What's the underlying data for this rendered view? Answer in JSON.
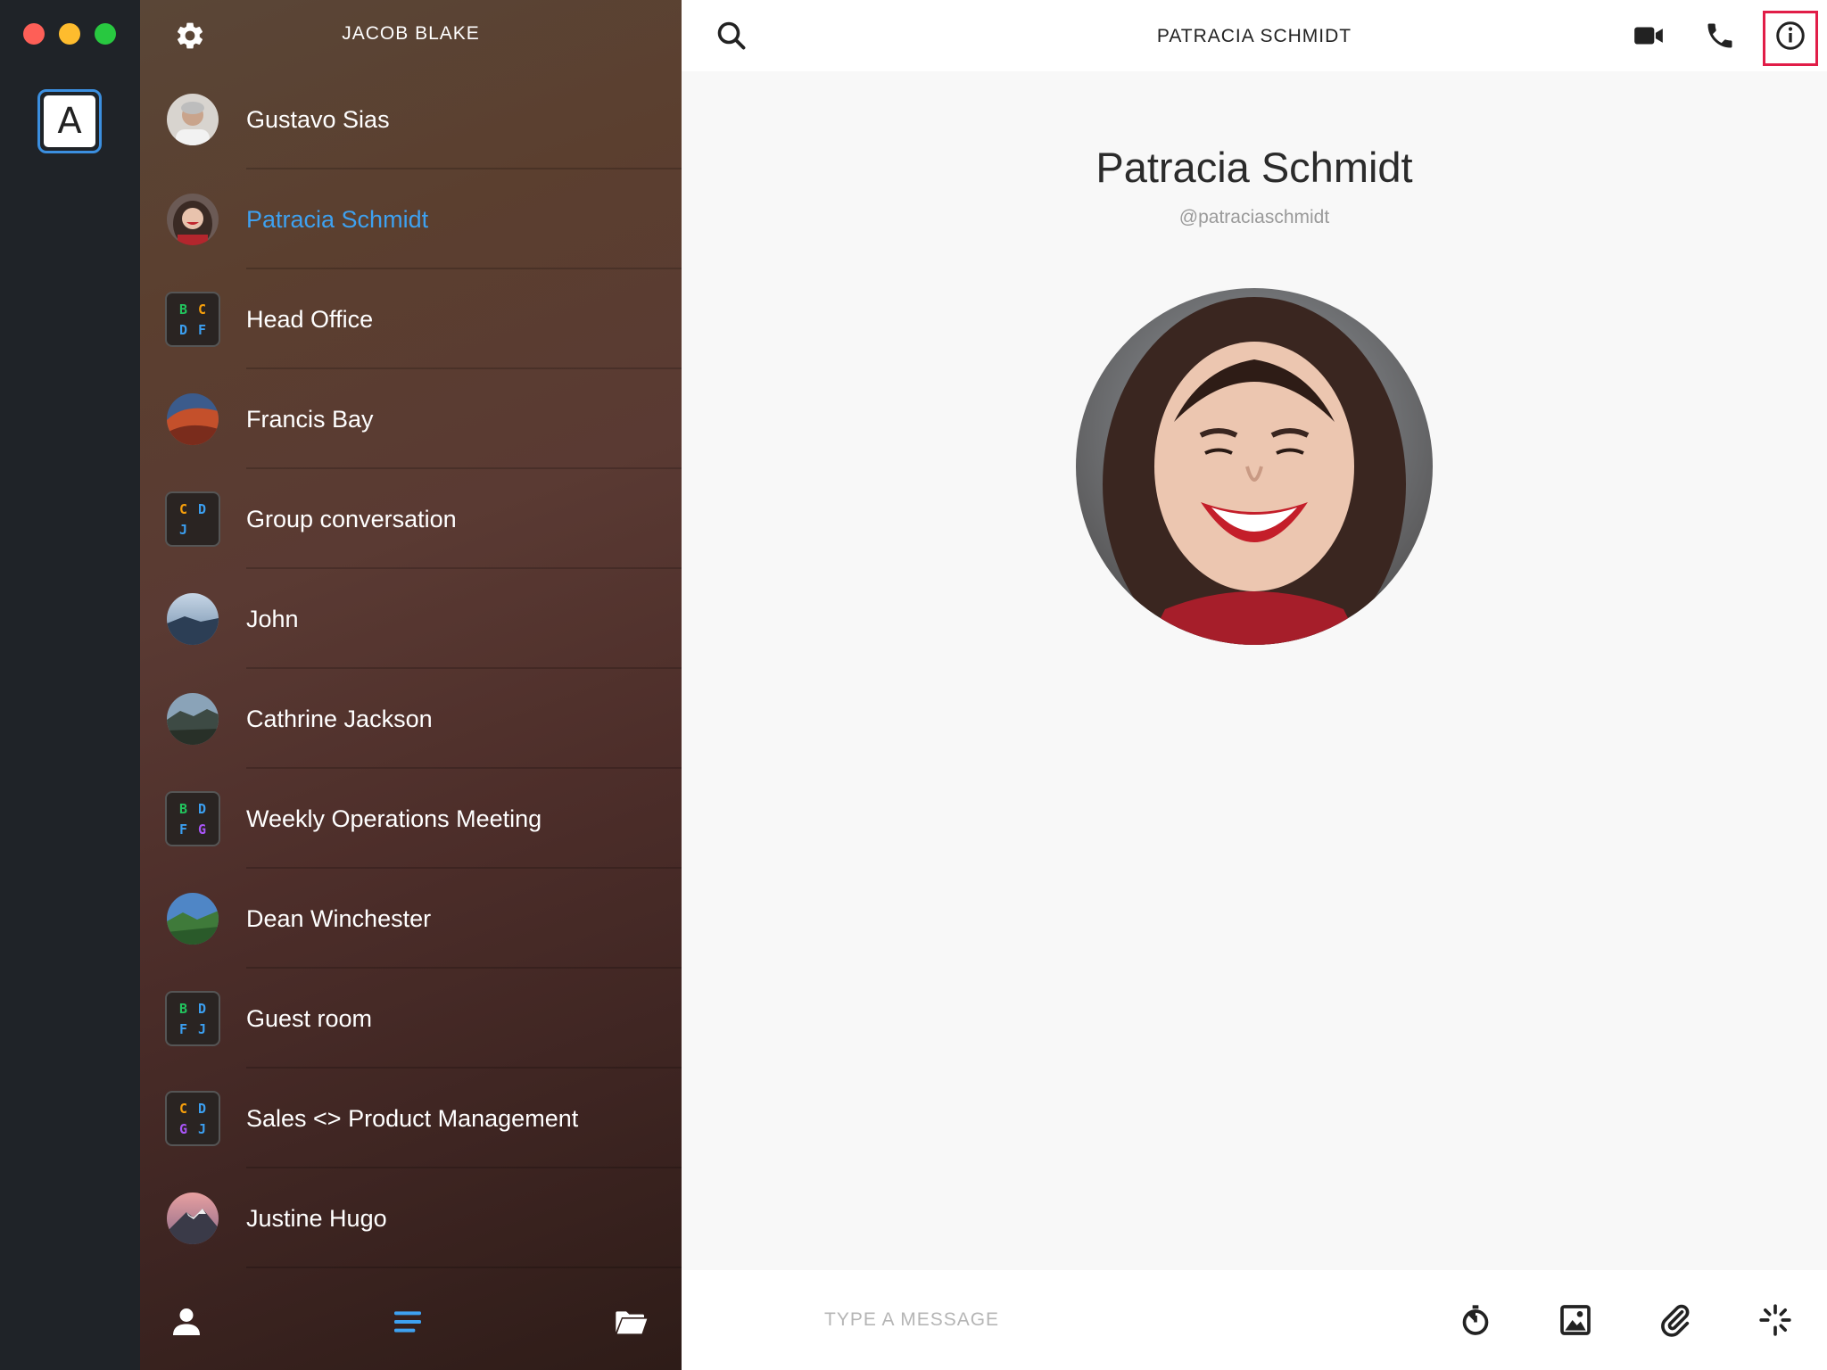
{
  "window": {
    "controls": [
      "close",
      "minimize",
      "zoom"
    ]
  },
  "workspace": {
    "letter": "A",
    "accent": "#3b8fe0"
  },
  "sidebar": {
    "user_name": "JACOB BLAKE",
    "conversations": [
      {
        "name": "Gustavo Sias",
        "type": "person"
      },
      {
        "name": "Patracia Schmidt",
        "type": "person",
        "active": true
      },
      {
        "name": "Head Office",
        "type": "group",
        "letters": [
          "B",
          "C",
          "D",
          "F"
        ]
      },
      {
        "name": "Francis Bay",
        "type": "person"
      },
      {
        "name": "Group conversation",
        "type": "group",
        "letters": [
          "C",
          "D",
          "J",
          ""
        ]
      },
      {
        "name": "John",
        "type": "person"
      },
      {
        "name": "Cathrine Jackson",
        "type": "person"
      },
      {
        "name": "Weekly Operations Meeting",
        "type": "group",
        "letters": [
          "B",
          "D",
          "F",
          "G"
        ]
      },
      {
        "name": "Dean Winchester",
        "type": "person"
      },
      {
        "name": "Guest room",
        "type": "group",
        "letters": [
          "B",
          "D",
          "F",
          "J"
        ]
      },
      {
        "name": "Sales <> Product Management",
        "type": "group",
        "letters": [
          "C",
          "D",
          "G",
          "J"
        ]
      },
      {
        "name": "Justine Hugo",
        "type": "person"
      }
    ],
    "letter_colors": {
      "B": "#22c55e",
      "C": "#f59e0b",
      "D": "#3b9ff0",
      "F": "#3b9ff0",
      "G": "#a855f7",
      "J": "#3b9ff0"
    }
  },
  "main": {
    "header_title": "PATRACIA SCHMIDT",
    "profile": {
      "name": "Patracia Schmidt",
      "handle": "@patraciaschmidt"
    },
    "composer": {
      "placeholder": "TYPE A MESSAGE",
      "value": ""
    }
  },
  "icons": {
    "header": [
      "search-icon",
      "video-call-icon",
      "phone-icon",
      "info-icon"
    ],
    "footer": [
      "person-icon",
      "conversations-icon",
      "folder-icon"
    ],
    "composer": [
      "timer-icon",
      "image-icon",
      "paperclip-icon",
      "sparkle-icon"
    ]
  }
}
